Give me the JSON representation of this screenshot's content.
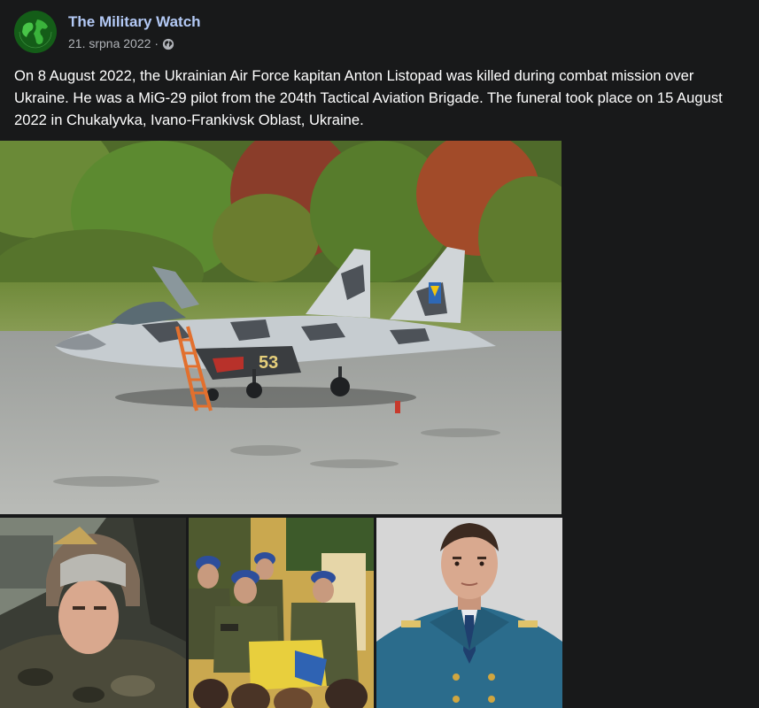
{
  "post": {
    "author": "The Military Watch",
    "date": "21. srpna 2022",
    "separator": "·",
    "audience_icon": "globe-icon",
    "avatar_icon": "globe-icon",
    "text": "On 8 August 2022, the Ukrainian Air Force kapitan Anton Listopad was killed during combat mission over Ukraine. He was a MiG-29 pilot from the 204th Tactical Aviation Brigade. The funeral took place on 15 August 2022 in Chukalyvka, Ivano-Frankivsk Oblast, Ukraine."
  },
  "photos": {
    "main": {
      "tail_number": "53"
    }
  },
  "colors": {
    "background": "#18191a",
    "author_link": "#b3c9f5",
    "meta_text": "#b0b3b8",
    "post_text": "#ffffff"
  }
}
